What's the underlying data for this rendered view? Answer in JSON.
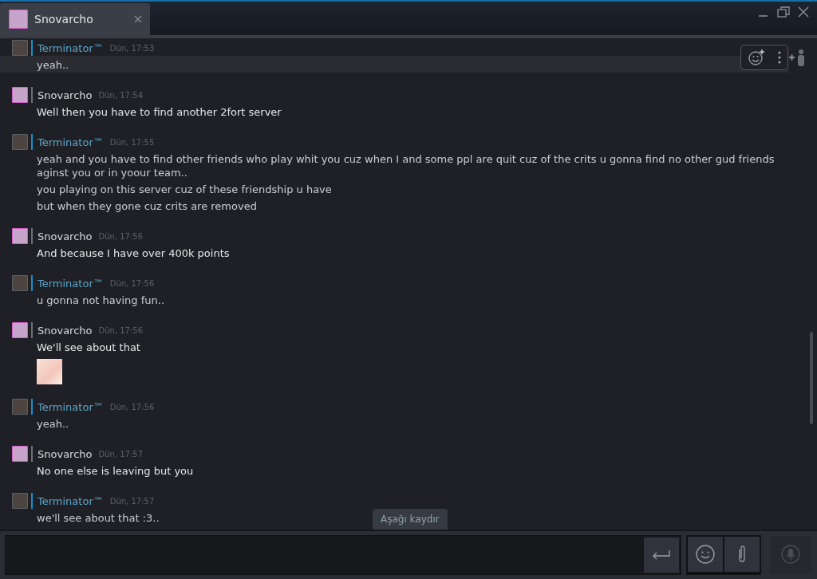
{
  "tab": {
    "title": "Snovarcho",
    "selected": true
  },
  "messages": [
    {
      "author": "Terminator™",
      "kind": "friend",
      "time": "Dün, 17:53",
      "highlighted": true,
      "lines": [
        "yeah.."
      ]
    },
    {
      "author": "Snovarcho",
      "kind": "self",
      "time": "Dün, 17:54",
      "highlighted": false,
      "lines": [
        "Well then you have to find another 2fort server"
      ]
    },
    {
      "author": "Terminator™",
      "kind": "friend",
      "time": "Dün, 17:55",
      "highlighted": false,
      "lines": [
        "yeah and you have to find other friends who play whit you cuz when I and some ppl are quit cuz of the crits u gonna find no other gud friends aginst you or in yoour team..",
        "you playing on this server cuz of these friendship u have",
        "but when they gone cuz crits are removed"
      ]
    },
    {
      "author": "Snovarcho",
      "kind": "self",
      "time": "Dün, 17:56",
      "highlighted": false,
      "lines": [
        "And because I have over 400k points"
      ]
    },
    {
      "author": "Terminator™",
      "kind": "friend",
      "time": "Dün, 17:56",
      "highlighted": false,
      "lines": [
        "u gonna not having fun.."
      ]
    },
    {
      "author": "Snovarcho",
      "kind": "self",
      "time": "Dün, 17:56",
      "highlighted": false,
      "lines": [
        "We'll see about that"
      ],
      "sticker": true
    },
    {
      "author": "Terminator™",
      "kind": "friend",
      "time": "Dün, 17:56",
      "highlighted": false,
      "lines": [
        "yeah.."
      ]
    },
    {
      "author": "Snovarcho",
      "kind": "self",
      "time": "Dün, 17:57",
      "highlighted": false,
      "lines": [
        "No one else is leaving but you"
      ]
    },
    {
      "author": "Terminator™",
      "kind": "friend",
      "time": "Dün, 17:57",
      "highlighted": false,
      "lines": [
        "we'll see about that :3.."
      ]
    }
  ],
  "scroll_down": "Aşağı kaydır"
}
